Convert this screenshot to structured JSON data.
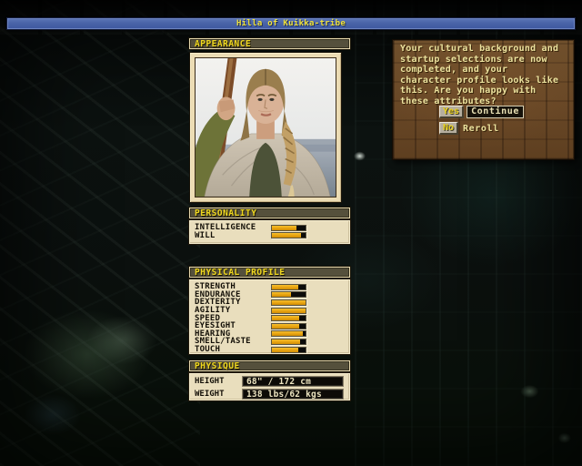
{
  "title_bar": {
    "text": "Hilla of Kuikka-tribe"
  },
  "appearance": {
    "header": "APPEARANCE"
  },
  "personality": {
    "header": "PERSONALITY",
    "stats": [
      {
        "label": "INTELLIGENCE",
        "fill": 72
      },
      {
        "label": "WILL",
        "fill": 86
      }
    ]
  },
  "physical_profile": {
    "header": "PHYSICAL PROFILE",
    "stats": [
      {
        "label": "STRENGTH",
        "fill": 78
      },
      {
        "label": "ENDURANCE",
        "fill": 57
      },
      {
        "label": "DEXTERITY",
        "fill": 100
      },
      {
        "label": "AGILITY",
        "fill": 100
      },
      {
        "label": "SPEED",
        "fill": 80
      },
      {
        "label": "EYESIGHT",
        "fill": 80
      },
      {
        "label": "HEARING",
        "fill": 92
      },
      {
        "label": "SMELL/TASTE",
        "fill": 83
      },
      {
        "label": "TOUCH",
        "fill": 78
      }
    ]
  },
  "physique": {
    "header": "PHYSIQUE",
    "rows": [
      {
        "label": "HEIGHT",
        "value": "68\" / 172 cm"
      },
      {
        "label": "WEIGHT",
        "value": "138 lbs/62 kgs"
      }
    ]
  },
  "dialog": {
    "lines": [
      "Your cultural background and",
      "startup selections are now",
      "completed, and your",
      "character profile looks like",
      "this. Are you happy with",
      "these attributes?"
    ],
    "yes_key": "Yes",
    "yes_action": "Continue",
    "no_key": "No",
    "no_action": "Reroll"
  },
  "colors": {
    "titlebar_blue": "#4a64a8",
    "header_yellow": "#f0d820",
    "panel_cream": "#e9debd",
    "bar_amber": "#e8a411",
    "dialog_wood": "#684726",
    "dialog_text": "#ece29e"
  }
}
